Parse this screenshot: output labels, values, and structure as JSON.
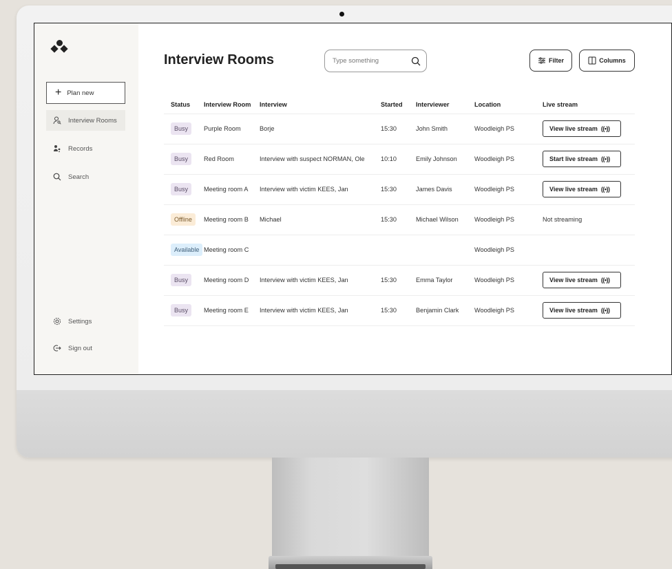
{
  "sidebar": {
    "plan_new": "Plan new",
    "items": [
      {
        "label": "Interview Rooms",
        "icon": "person-search-icon"
      },
      {
        "label": "Records",
        "icon": "records-icon"
      },
      {
        "label": "Search",
        "icon": "search-icon"
      }
    ],
    "settings": "Settings",
    "sign_out": "Sign out"
  },
  "header": {
    "title": "Interview Rooms",
    "search_placeholder": "Type something",
    "filter_label": "Filter",
    "columns_label": "Columns"
  },
  "table": {
    "columns": [
      "Status",
      "Interview Room",
      "Interview",
      "Started",
      "Interviewer",
      "Location",
      "Live stream"
    ],
    "rows": [
      {
        "status": "Busy",
        "room": "Purple Room",
        "interview": "Borje",
        "started": "15:30",
        "interviewer": "John Smith",
        "location": "Woodleigh PS",
        "stream_label": "View live stream",
        "stream_text": ""
      },
      {
        "status": "Busy",
        "room": "Red Room",
        "interview": "Interview with suspect NORMAN, Ole",
        "started": "10:10",
        "interviewer": "Emily Johnson",
        "location": "Woodleigh PS",
        "stream_label": "Start live stream",
        "stream_text": ""
      },
      {
        "status": "Busy",
        "room": "Meeting room A",
        "interview": "Interview with victim KEES, Jan",
        "started": "15:30",
        "interviewer": "James Davis",
        "location": "Woodleigh PS",
        "stream_label": "View live stream",
        "stream_text": ""
      },
      {
        "status": "Offline",
        "room": "Meeting room B",
        "interview": "Michael",
        "started": "15:30",
        "interviewer": "Michael Wilson",
        "location": "Woodleigh PS",
        "stream_label": "",
        "stream_text": "Not streaming"
      },
      {
        "status": "Available",
        "room": "Meeting room C",
        "interview": "",
        "started": "",
        "interviewer": "",
        "location": "Woodleigh PS",
        "stream_label": "",
        "stream_text": ""
      },
      {
        "status": "Busy",
        "room": "Meeting room D",
        "interview": "Interview with victim KEES, Jan",
        "started": "15:30",
        "interviewer": "Emma Taylor",
        "location": "Woodleigh PS",
        "stream_label": "View live stream",
        "stream_text": ""
      },
      {
        "status": "Busy",
        "room": "Meeting room E",
        "interview": "Interview with victim KEES, Jan",
        "started": "15:30",
        "interviewer": "Benjamin Clark",
        "location": "Woodleigh PS",
        "stream_label": "View live stream",
        "stream_text": ""
      }
    ]
  },
  "stream_icon_glyph": "((•))",
  "colors": {
    "busy_bg": "#ebe4f1",
    "offline_bg": "#fbecd7",
    "available_bg": "#dceefb",
    "sidebar_bg": "#f7f6f3"
  }
}
